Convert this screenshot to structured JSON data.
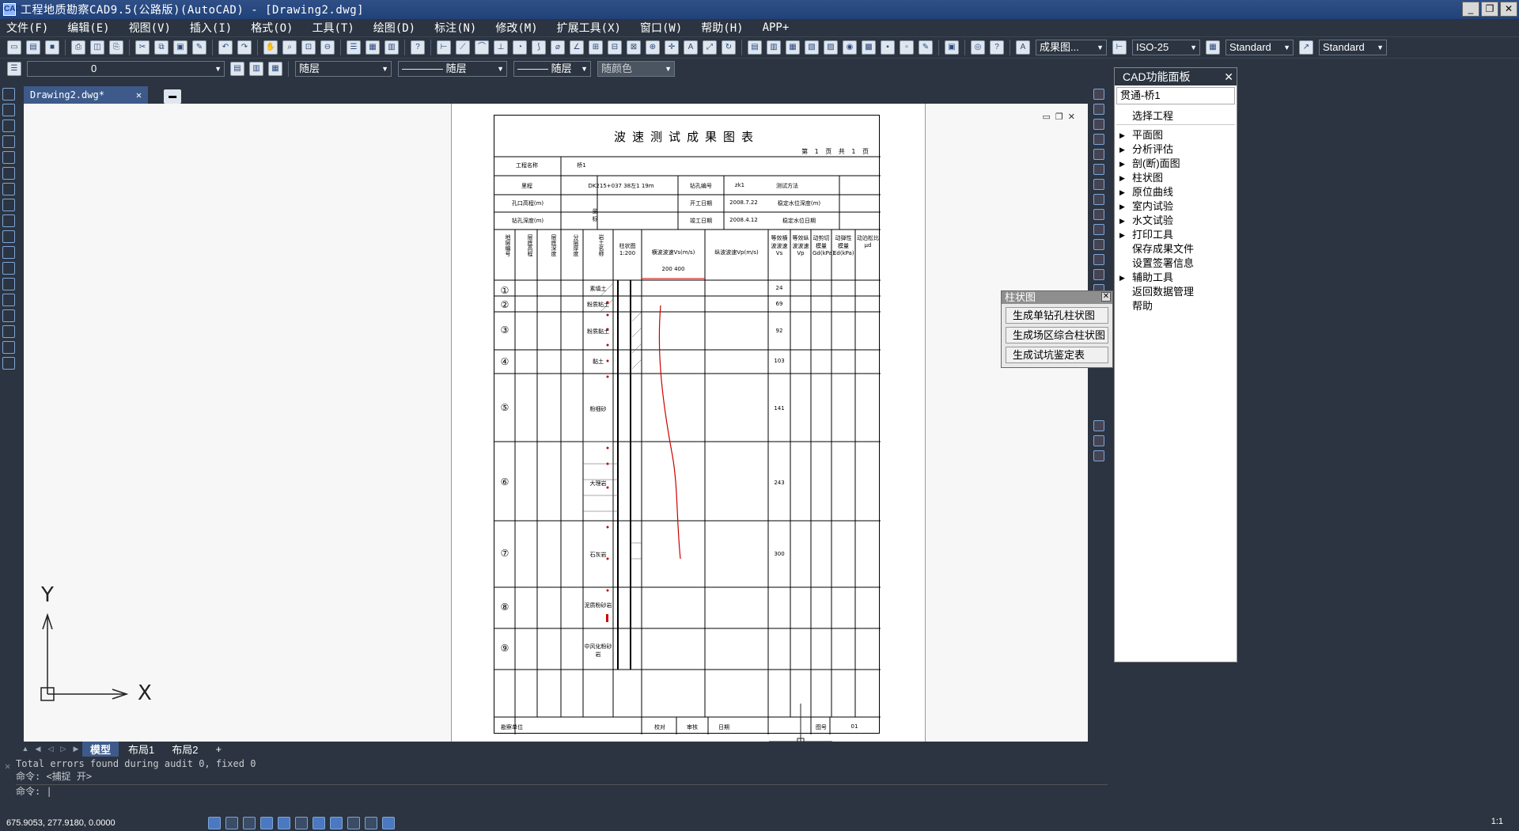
{
  "titlebar": {
    "title": "工程地质勘察CAD9.5(公路版)(AutoCAD) - [Drawing2.dwg]",
    "minimize": "_",
    "restore": "❐",
    "close": "✕"
  },
  "menubar": {
    "items": [
      "文件(F)",
      "编辑(E)",
      "视图(V)",
      "插入(I)",
      "格式(O)",
      "工具(T)",
      "绘图(D)",
      "标注(N)",
      "修改(M)",
      "扩展工具(X)",
      "窗口(W)",
      "帮助(H)",
      "APP+"
    ]
  },
  "toolbar1": {
    "text_style_value": "成果图...",
    "dim_style_value": "ISO-25",
    "table_style_value": "Standard",
    "mleader_style_value": "Standard"
  },
  "toolbar2": {
    "layer_value": "0",
    "color_value": "随层",
    "linetype_value": "———— 随层",
    "lineweight_value": "——— 随层",
    "plotstyle_value": "随颜色"
  },
  "doc_tabs": {
    "active_tab": "Drawing2.dwg*",
    "close": "✕"
  },
  "drawing": {
    "title": "波速测试成果图表",
    "page_info": "第 1 页  共 1 页",
    "ucs_x": "X",
    "ucs_y": "Y",
    "rows_labels": [
      "①",
      "②",
      "③",
      "④",
      "⑤",
      "⑥",
      "⑦",
      "⑧",
      "⑨"
    ],
    "header_labels": [
      "工程名称",
      "桥1",
      "里程",
      "DK215+037 38左1 19m",
      "钻孔编号",
      "zk1",
      "测试方法",
      "孔口高程(m)",
      "坐标",
      "开工日期",
      "2008.7.22",
      "稳定水位深度(m)",
      "钻孔深度(m)",
      "竣工日期",
      "2008.4.12",
      "稳定水位日期"
    ],
    "column_labels": [
      "地层编号",
      "层底高程",
      "层底深度",
      "分层厚度",
      "岩土名称",
      "柱状图 1:200",
      "横波波速Vs(m/s)",
      "纵波波速Vp(m/s)",
      "等效横波波速Vs",
      "等效纵波波速Vp",
      "动剪切模量Gd(kPa)",
      "动弹性模量Ed(kPa)",
      "动泊松比μd"
    ],
    "scale_ticks": "200 400",
    "soil_names": [
      "素填土",
      "粉质粘土",
      "粉质黏土",
      "黏土",
      "粉细砂",
      "大理岩",
      "石灰岩",
      "泥质粉砂岩",
      "中风化粉砂岩"
    ],
    "vs_values": [
      "24",
      "69",
      "92",
      "103",
      "141",
      "243",
      "300",
      "",
      ""
    ],
    "footer_labels": [
      "勘察单位",
      "校对",
      "审核",
      "日期",
      "图号",
      "01"
    ]
  },
  "right_panel": {
    "title": "CAD功能面板",
    "close": "✕",
    "project": "贯通-桥1",
    "select_project": "选择工程",
    "items": [
      {
        "label": "平面图",
        "expandable": true
      },
      {
        "label": "分析评估",
        "expandable": true
      },
      {
        "label": "剖(断)面图",
        "expandable": true
      },
      {
        "label": "柱状图",
        "expandable": true
      },
      {
        "label": "原位曲线",
        "expandable": true
      },
      {
        "label": "室内试验",
        "expandable": true
      },
      {
        "label": "水文试验",
        "expandable": true
      },
      {
        "label": "打印工具",
        "expandable": true
      },
      {
        "label": "保存成果文件",
        "expandable": false
      },
      {
        "label": "设置签署信息",
        "expandable": false
      },
      {
        "label": "辅助工具",
        "expandable": true
      },
      {
        "label": "返回数据管理",
        "expandable": false
      },
      {
        "label": "帮助",
        "expandable": false
      }
    ]
  },
  "popup": {
    "title": "柱状图",
    "close": "✕",
    "buttons": [
      "生成单钻孔柱状图",
      "生成场区综合柱状图",
      "生成试坑鉴定表"
    ]
  },
  "layout_tabs": {
    "tabs": [
      "模型",
      "布局1",
      "布局2"
    ],
    "add": "+"
  },
  "command": {
    "line1": "Total errors found during audit 0, fixed 0",
    "line2": "命令:  <捕捉 开>",
    "prompt": "命令:"
  },
  "status": {
    "coords": "675.9053, 277.9180, 0.0000",
    "scale": "1:1"
  },
  "colors": {
    "ui_dark": "#2b3440",
    "accent": "#3d5a8a",
    "curve_red": "#cc0000"
  }
}
